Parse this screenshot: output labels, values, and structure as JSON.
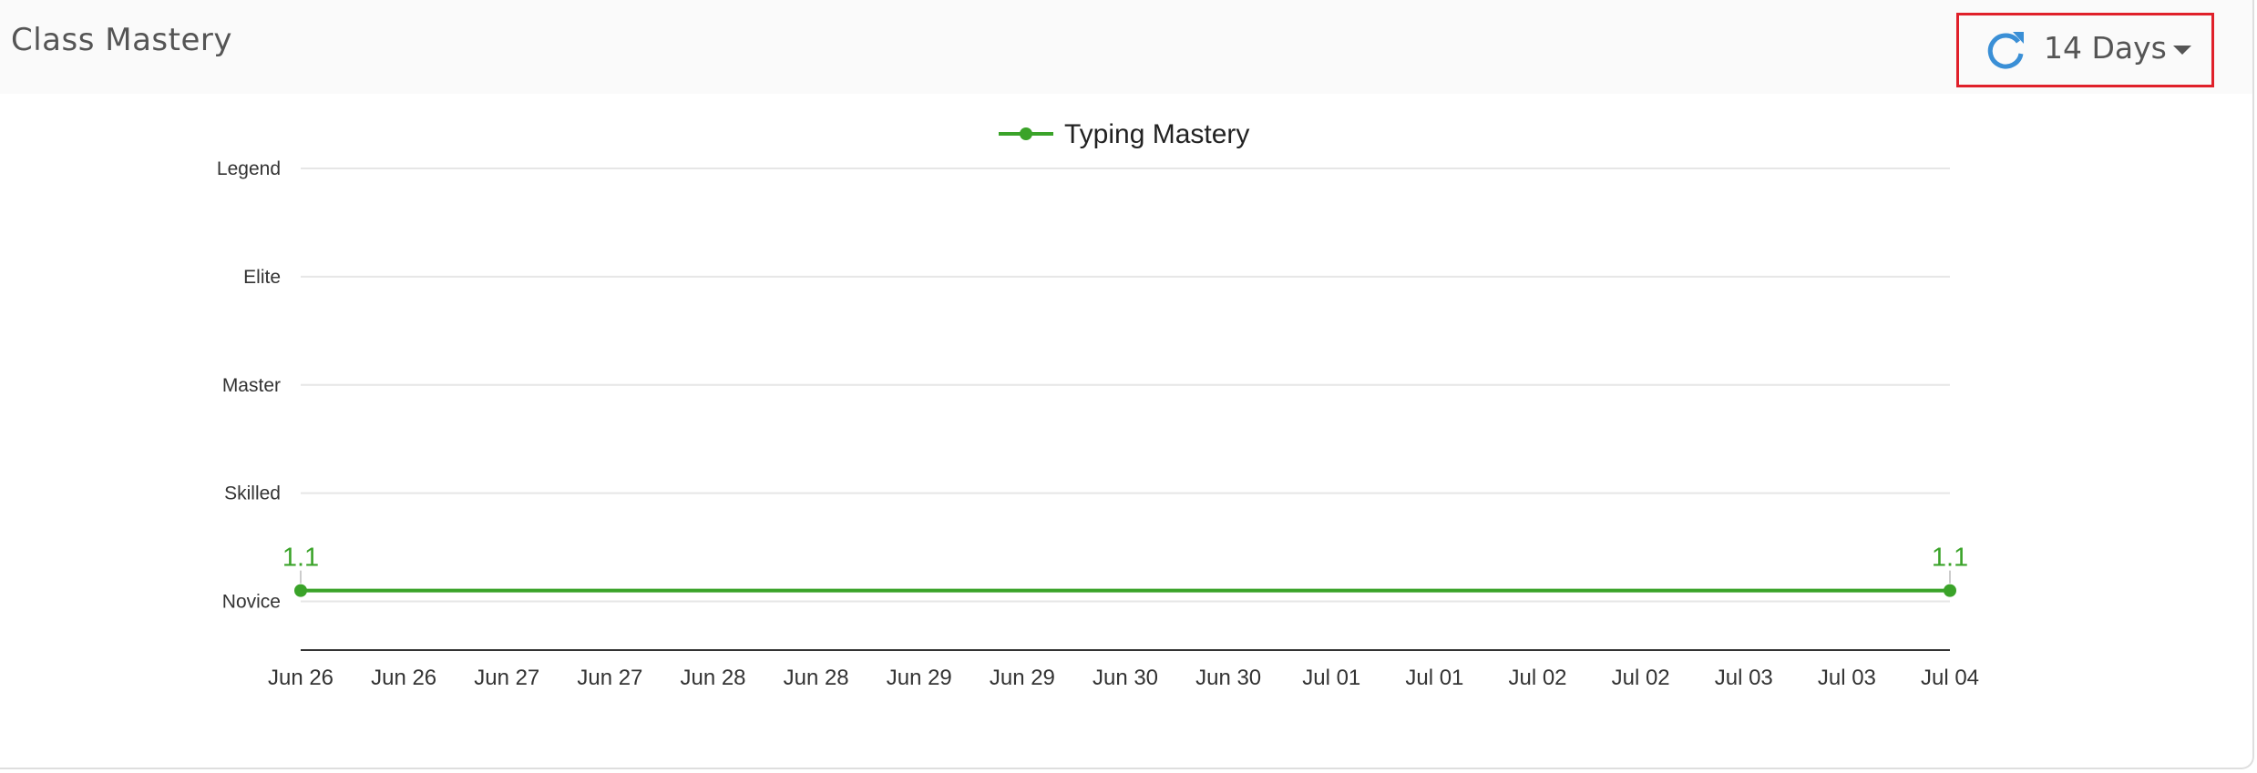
{
  "card": {
    "title": "Class Mastery"
  },
  "range_control": {
    "selected": "14 Days",
    "icons": {
      "refresh": "refresh-icon",
      "caret": "caret-down-icon"
    }
  },
  "colors": {
    "series": "#3aa329",
    "refresh_icon": "#3a8fd6",
    "highlight_border": "#e0202a"
  },
  "chart_data": {
    "type": "line",
    "title": "",
    "xlabel": "",
    "ylabel": "",
    "x": [
      "Jun 26",
      "Jun 26",
      "Jun 27",
      "Jun 27",
      "Jun 28",
      "Jun 28",
      "Jun 29",
      "Jun 29",
      "Jun 30",
      "Jun 30",
      "Jul 01",
      "Jul 01",
      "Jul 02",
      "Jul 02",
      "Jul 03",
      "Jul 03",
      "Jul 04"
    ],
    "y_levels": [
      "Novice",
      "Skilled",
      "Master",
      "Elite",
      "Legend"
    ],
    "ylim": [
      0.55,
      5.0
    ],
    "grid": true,
    "legend": "top-center",
    "series": [
      {
        "name": "Typing Mastery",
        "points": [
          {
            "x_index": 0,
            "y": 1.1,
            "label": "1.1"
          },
          {
            "x_index": 16,
            "y": 1.1,
            "label": "1.1"
          }
        ]
      }
    ]
  }
}
